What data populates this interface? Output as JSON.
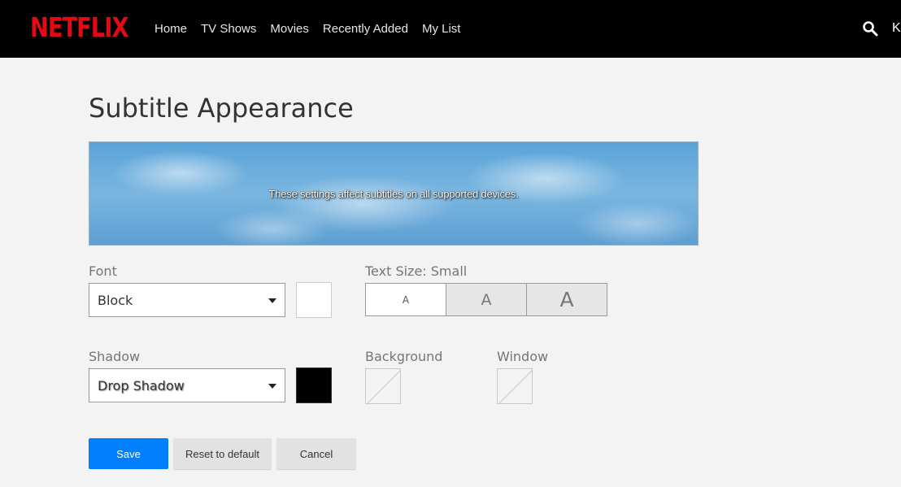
{
  "header": {
    "logo": "NETFLIX",
    "nav": [
      "Home",
      "TV Shows",
      "Movies",
      "Recently Added",
      "My List"
    ],
    "profile_initial": "K",
    "search_icon": "search-icon"
  },
  "page": {
    "title": "Subtitle Appearance",
    "preview_text": "These settings affect subtitles on all supported devices."
  },
  "font": {
    "label": "Font",
    "value": "Block",
    "color": "#ffffff"
  },
  "text_size": {
    "label": "Text Size: Small",
    "options": [
      "A",
      "A",
      "A"
    ],
    "selected_index": 0
  },
  "shadow": {
    "label": "Shadow",
    "value": "Drop Shadow",
    "color": "#000000"
  },
  "background": {
    "label": "Background"
  },
  "window": {
    "label": "Window"
  },
  "actions": {
    "save": "Save",
    "reset": "Reset to default",
    "cancel": "Cancel"
  },
  "colors": {
    "brand": "#e50914",
    "primary_button": "#0080ff"
  }
}
